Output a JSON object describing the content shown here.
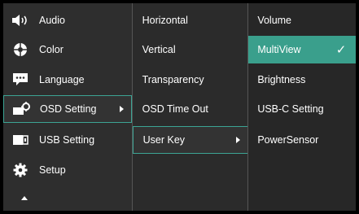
{
  "main_menu": [
    {
      "label": "Audio",
      "icon": "speaker-icon"
    },
    {
      "label": "Color",
      "icon": "color-wheel-icon"
    },
    {
      "label": "Language",
      "icon": "speech-bubble-icon"
    },
    {
      "label": "OSD Setting",
      "icon": "osd-gear-icon",
      "selected": true
    },
    {
      "label": "USB Setting",
      "icon": "usb-icon"
    },
    {
      "label": "Setup",
      "icon": "gear-icon"
    }
  ],
  "submenu": [
    {
      "label": "Horizontal"
    },
    {
      "label": "Vertical"
    },
    {
      "label": "Transparency"
    },
    {
      "label": "OSD Time Out"
    },
    {
      "label": "User Key",
      "selected": true
    }
  ],
  "options": [
    {
      "label": "Volume"
    },
    {
      "label": "MultiView",
      "highlighted": true,
      "checked": true
    },
    {
      "label": "Brightness"
    },
    {
      "label": "USB-C Setting"
    },
    {
      "label": "PowerSensor"
    }
  ],
  "check_glyph": "✓",
  "colors": {
    "accent": "#3a9f8c",
    "selection_border": "#3ca494",
    "panel": "#2e2e2e"
  }
}
